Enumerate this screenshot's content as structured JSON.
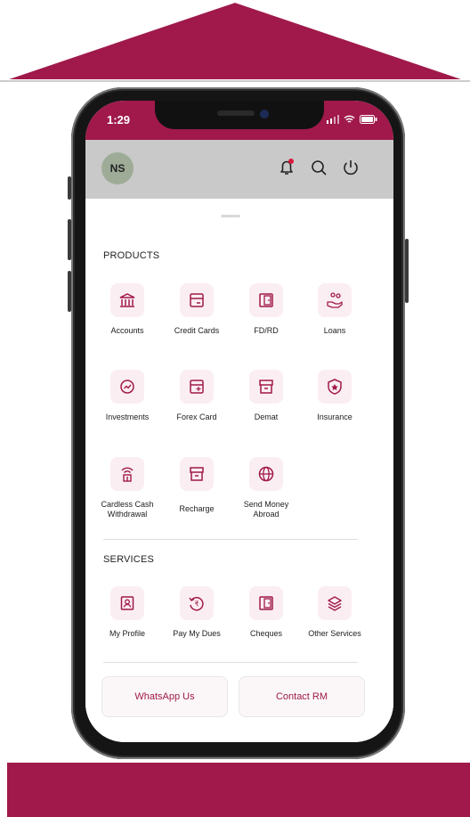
{
  "colors": {
    "brand": "#a0194a",
    "icon_bg": "#fbeef2",
    "header_bg": "#c9c9c9"
  },
  "status": {
    "time": "1:29"
  },
  "header": {
    "avatar_initials": "NS"
  },
  "products": {
    "title": "PRODUCTS",
    "items": [
      {
        "label": "Accounts",
        "icon": "bank-icon"
      },
      {
        "label": "Credit Cards",
        "icon": "card-icon"
      },
      {
        "label": "FD/RD",
        "icon": "door-icon"
      },
      {
        "label": "Loans",
        "icon": "loan-hand-icon"
      },
      {
        "label": "Investments",
        "icon": "growth-icon"
      },
      {
        "label": "Forex Card",
        "icon": "forex-card-icon"
      },
      {
        "label": "Demat",
        "icon": "box-icon"
      },
      {
        "label": "Insurance",
        "icon": "shield-star-icon"
      },
      {
        "label": "Cardless Cash Withdrawal",
        "icon": "atm-wireless-icon"
      },
      {
        "label": "Recharge",
        "icon": "box-icon"
      },
      {
        "label": "Send Money Abroad",
        "icon": "globe-icon"
      }
    ]
  },
  "services": {
    "title": "SERVICES",
    "items": [
      {
        "label": "My Profile",
        "icon": "profile-icon"
      },
      {
        "label": "Pay My Dues",
        "icon": "rupee-refresh-icon"
      },
      {
        "label": "Cheques",
        "icon": "cheque-icon"
      },
      {
        "label": "Other Services",
        "icon": "layers-icon"
      }
    ]
  },
  "actions": {
    "whatsapp": "WhatsApp Us",
    "contact_rm": "Contact RM"
  }
}
